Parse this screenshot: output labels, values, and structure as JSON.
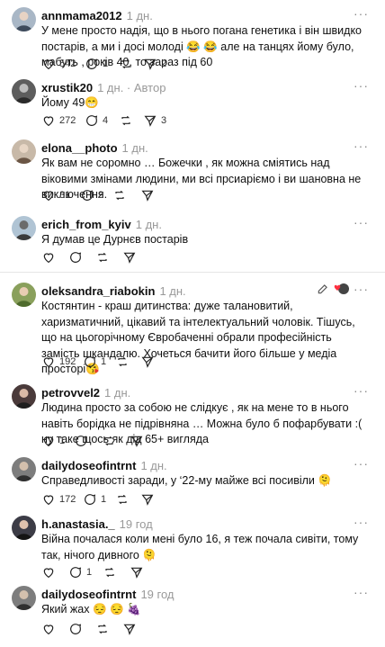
{
  "comments": [
    {
      "username": "annmama2012",
      "time": "1 дн.",
      "text": "У мене просто надія, що в нього погана генетика і він швидко постарів, а ми і досі молоді 😂 😂  але на танцях йому було, мабуть , років 40, то зараз під 60",
      "likes": "542",
      "replies": "1",
      "shares": "2"
    },
    {
      "username": "xrustik20",
      "time": "1 дн.",
      "author_label": "Автор",
      "text": "Йому 49😁",
      "likes": "272",
      "replies": "4",
      "shares": "3"
    },
    {
      "username": "elona__photo",
      "time": "1 дн.",
      "text": "Як вам не соромно … Божечки , як можна сміятись над віковими змінами людини, ми всі прсиаріємо і ви шановна не виключення.",
      "likes": "31",
      "replies": "3",
      "shares": ""
    },
    {
      "username": "erich_from_kyiv",
      "time": "1 дн.",
      "text": "Я думав це Дурнєв постарів",
      "likes": "",
      "replies": "",
      "shares": ""
    },
    {
      "username": "oleksandra_riabokin",
      "time": "1 дн.",
      "text": "Костянтин - краш дитинства: дуже талановитий, харизматичний, цікавий та інтелектуальний чоловік. Тішусь, що на цьогорічному Євробаченні обрали професійність замість шкандалю. Хочеться бачити його більше у медіа просторі😘",
      "likes": "192",
      "replies": "1",
      "shares": ""
    },
    {
      "username": "petrovvel2",
      "time": "1 дн.",
      "text": "Людина просто за собою не слідкує , як на мене то в нього навіть борідка не підрівняна … Можна було б пофарбувати :( ну таке щось як дід 65+ вигляда",
      "likes": "",
      "replies": "1",
      "shares": ""
    },
    {
      "username": "dailydoseofintrnt",
      "time": "1 дн.",
      "text": "Справедливості заради, у ‘22-му майже всі посивіли 🫠",
      "likes": "172",
      "replies": "1",
      "shares": ""
    },
    {
      "username": "h.anastasia._",
      "time": "19 год",
      "text": "Війна почалася коли мені було 16, я теж почала сивіти, тому так, нічого дивного 🫠",
      "likes": "",
      "replies": "1",
      "shares": ""
    },
    {
      "username": "dailydoseofintrnt",
      "time": "19 год",
      "text": "Який жах 😔 😔 🍇",
      "likes": "",
      "replies": "",
      "shares": ""
    }
  ],
  "icons": {
    "more": "more-dots-icon",
    "like": "heart-icon",
    "reply": "comment-icon",
    "repost": "repost-icon",
    "share": "send-icon",
    "edit": "pencil-icon"
  },
  "colors": {
    "text": "#101010",
    "muted": "#999999",
    "divider": "#e6e6e6"
  }
}
